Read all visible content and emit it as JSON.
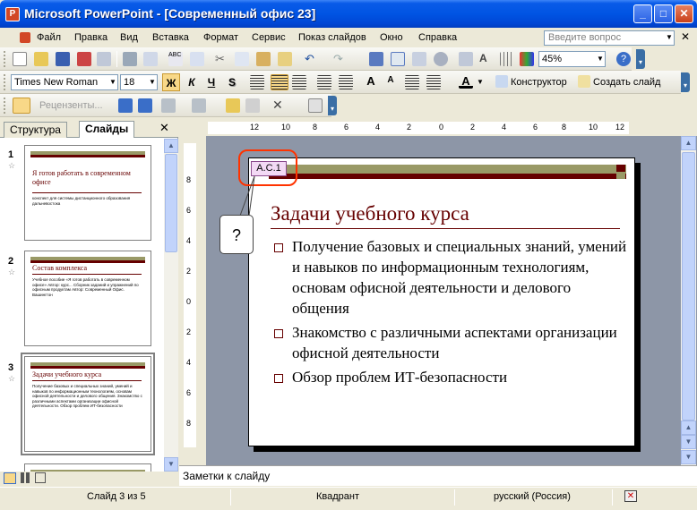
{
  "window": {
    "title": "Microsoft PowerPoint - [Современный офис 23]",
    "icon": "powerpoint-icon",
    "app_icon_letter": "P"
  },
  "menu": {
    "items": [
      "Файл",
      "Правка",
      "Вид",
      "Вставка",
      "Формат",
      "Сервис",
      "Показ слайдов",
      "Окно",
      "Справка"
    ],
    "help_placeholder": "Введите вопрос"
  },
  "toolbar": {
    "zoom": "45%"
  },
  "format_toolbar": {
    "font": "Times New Roman",
    "size": "18",
    "bold": "Ж",
    "italic": "К",
    "underline": "Ч",
    "shadow": "S",
    "designer": "Конструктор",
    "new_slide": "Создать слайд"
  },
  "review_toolbar": {
    "reviewers": "Рецензенты..."
  },
  "panel": {
    "tab_outline": "Структура",
    "tab_slides": "Слайды",
    "close": "✕"
  },
  "thumbnails": [
    {
      "num": "1",
      "title": "Я готов работать в современном офисе",
      "body": "конспект для системы дистанционного образования дальневостока"
    },
    {
      "num": "2",
      "title": "Состав комплекса",
      "body": "Учебное пособие «Я готов работать в современном офисе» Автор: курс... Сборник заданий и упражнений по офисным продуктам Автор: Современный Офис. Вашингтон"
    },
    {
      "num": "3",
      "title": "Задачи учебного курса",
      "body": "Получение базовых и специальных знаний, умений и навыков по информационным технологиям, основам офисной деятельности и делового общения. Знакомство с различными аспектами организации офисной деятельности. Обзор проблем ИТ-безопасности"
    }
  ],
  "ruler": {
    "h": [
      "12",
      "10",
      "8",
      "6",
      "4",
      "2",
      "0",
      "2",
      "4",
      "6",
      "8",
      "10",
      "12"
    ],
    "v": [
      "8",
      "6",
      "4",
      "2",
      "0",
      "2",
      "4",
      "6",
      "8"
    ]
  },
  "slide": {
    "comment": "А.С.1",
    "callout": "?",
    "title": "Задачи учебного курса",
    "bullets": [
      "Получение базовых и специальных знаний, умений и навыков по информационным технологиям, основам офисной деятельности и делового общения",
      "Знакомство с различными аспектами организации офисной деятельности",
      "Обзор проблем ИТ-безопасности"
    ]
  },
  "notes": {
    "placeholder": "Заметки к слайду"
  },
  "status": {
    "slide": "Слайд 3 из 5",
    "design": "Квадрант",
    "language": "русский (Россия)"
  },
  "colors": {
    "title_bar": "#0054e3",
    "accent_dark": "#660000",
    "accent_olive": "#999966",
    "callout_ring": "#ff3300"
  }
}
